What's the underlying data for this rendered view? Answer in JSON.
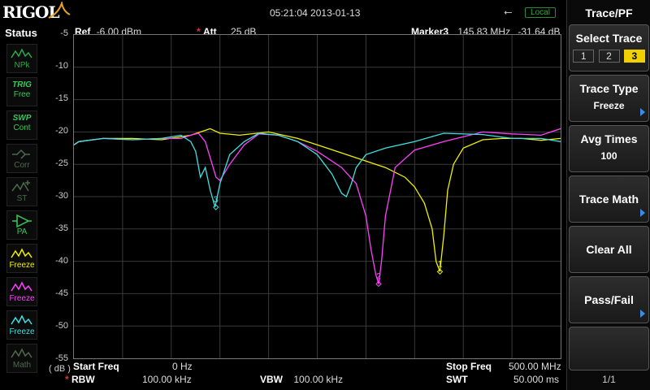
{
  "brand": "RIGOL",
  "datetime": "05:21:04 2013-01-13",
  "local_badge": "Local",
  "status": {
    "title": "Status",
    "items": [
      {
        "label": "NPk",
        "color": "#2aa84a",
        "kind": "wave"
      },
      {
        "top": "TRIG",
        "label": "Free",
        "color": "#36c95a",
        "kind": "text"
      },
      {
        "top": "SWP",
        "label": "Cont",
        "color": "#36c95a",
        "kind": "text"
      },
      {
        "label": "Corr",
        "color": "#4c6a4c",
        "kind": "diamond"
      },
      {
        "label": "ST",
        "color": "#4c6a4c",
        "kind": "sweep"
      },
      {
        "label": "PA",
        "color": "#36c95a",
        "kind": "amp"
      },
      {
        "label": "Freeze",
        "color": "#f0f000",
        "kind": "wave"
      },
      {
        "label": "Freeze",
        "color": "#ff40ff",
        "kind": "wave"
      },
      {
        "label": "Freeze",
        "color": "#40e0e0",
        "kind": "wave"
      },
      {
        "label": "Math",
        "color": "#4c6a4c",
        "kind": "wave"
      }
    ]
  },
  "header": {
    "ref_label": "Ref",
    "ref_value": "-6.00 dBm",
    "att_label": "Att",
    "att_value": "25 dB",
    "marker_label": "Marker3",
    "marker_freq": "145.83 MHz",
    "marker_amp": "-31.64 dB"
  },
  "footer": {
    "start_label": "Start Freq",
    "start_value": "0 Hz",
    "stop_label": "Stop Freq",
    "stop_value": "500.00 MHz",
    "rbw_label": "RBW",
    "rbw_value": "100.00 kHz",
    "vbw_label": "VBW",
    "vbw_value": "100.00 kHz",
    "swt_label": "SWT",
    "swt_value": "50.000 ms"
  },
  "y_unit": "( dB )",
  "menu": {
    "title": "Trace/PF",
    "select_trace": {
      "label": "Select Trace",
      "options": [
        "1",
        "2",
        "3"
      ],
      "selected": "3"
    },
    "trace_type": {
      "label": "Trace Type",
      "value": "Freeze"
    },
    "avg_times": {
      "label": "Avg Times",
      "value": "100"
    },
    "trace_math": {
      "label": "Trace Math"
    },
    "clear_all": {
      "label": "Clear All"
    },
    "pass_fail": {
      "label": "Pass/Fail"
    },
    "page": "1/1"
  },
  "chart_data": {
    "type": "line",
    "x_unit": "MHz",
    "xlim": [
      0,
      500
    ],
    "ylim": [
      -55,
      -5
    ],
    "y_ticks": [
      "-5",
      "-10",
      "-15",
      "-20",
      "-25",
      "-30",
      "-35",
      "-40",
      "-45",
      "-50",
      "-55"
    ],
    "grid": true,
    "series": [
      {
        "color": "#f0f000",
        "x": [
          0,
          5,
          30,
          60,
          90,
          120,
          130,
          140,
          150,
          170,
          200,
          230,
          260,
          290,
          320,
          340,
          350,
          360,
          368,
          372,
          376,
          380,
          384,
          390,
          400,
          420,
          440,
          460,
          480,
          500
        ],
        "y": [
          -22,
          -21.5,
          -21,
          -21,
          -21.2,
          -20.5,
          -20,
          -19.5,
          -20.2,
          -20.5,
          -20,
          -21,
          -22.5,
          -24,
          -25.5,
          -27,
          -28.5,
          -31,
          -35,
          -40,
          -41.6,
          -36,
          -29,
          -25,
          -22.5,
          -21.2,
          -21,
          -21,
          -21.3,
          -21
        ],
        "markers": [
          {
            "id": "1",
            "x": 376,
            "y": -41.6
          }
        ]
      },
      {
        "color": "#ff40ff",
        "x": [
          0,
          5,
          30,
          60,
          90,
          110,
          120,
          128,
          135,
          140,
          146,
          150,
          160,
          175,
          190,
          210,
          230,
          250,
          275,
          290,
          300,
          305,
          310,
          313,
          316,
          320,
          330,
          350,
          380,
          420,
          450,
          480,
          500
        ],
        "y": [
          -22,
          -21.5,
          -21,
          -21.2,
          -21,
          -21,
          -20.5,
          -20.2,
          -21.5,
          -24,
          -27,
          -27.5,
          -25,
          -22,
          -20.3,
          -20.5,
          -21.5,
          -23,
          -25.5,
          -28,
          -33,
          -38,
          -42,
          -43.5,
          -40,
          -33,
          -25.5,
          -22.8,
          -21.5,
          -20,
          -20.3,
          -20.5,
          -19.5
        ],
        "markers": [
          {
            "id": "2",
            "x": 313,
            "y": -43.5
          }
        ]
      },
      {
        "color": "#40e0e0",
        "x": [
          0,
          5,
          30,
          60,
          90,
          110,
          120,
          125,
          130,
          135,
          140,
          145,
          150,
          160,
          175,
          190,
          210,
          230,
          250,
          265,
          275,
          280,
          285,
          290,
          300,
          320,
          350,
          380,
          420,
          450,
          480,
          500
        ],
        "y": [
          -22,
          -21.5,
          -21,
          -21.2,
          -21,
          -20.5,
          -21.5,
          -23,
          -27,
          -25.5,
          -29,
          -31.6,
          -28,
          -23.5,
          -21.5,
          -20.2,
          -20.5,
          -21.5,
          -23.5,
          -26.5,
          -29.5,
          -30,
          -28,
          -25.5,
          -23.5,
          -22.5,
          -21.5,
          -20.2,
          -20.4,
          -21,
          -21,
          -21.5
        ],
        "markers": [
          {
            "id": "3",
            "x": 145.83,
            "y": -31.64
          }
        ]
      }
    ]
  }
}
